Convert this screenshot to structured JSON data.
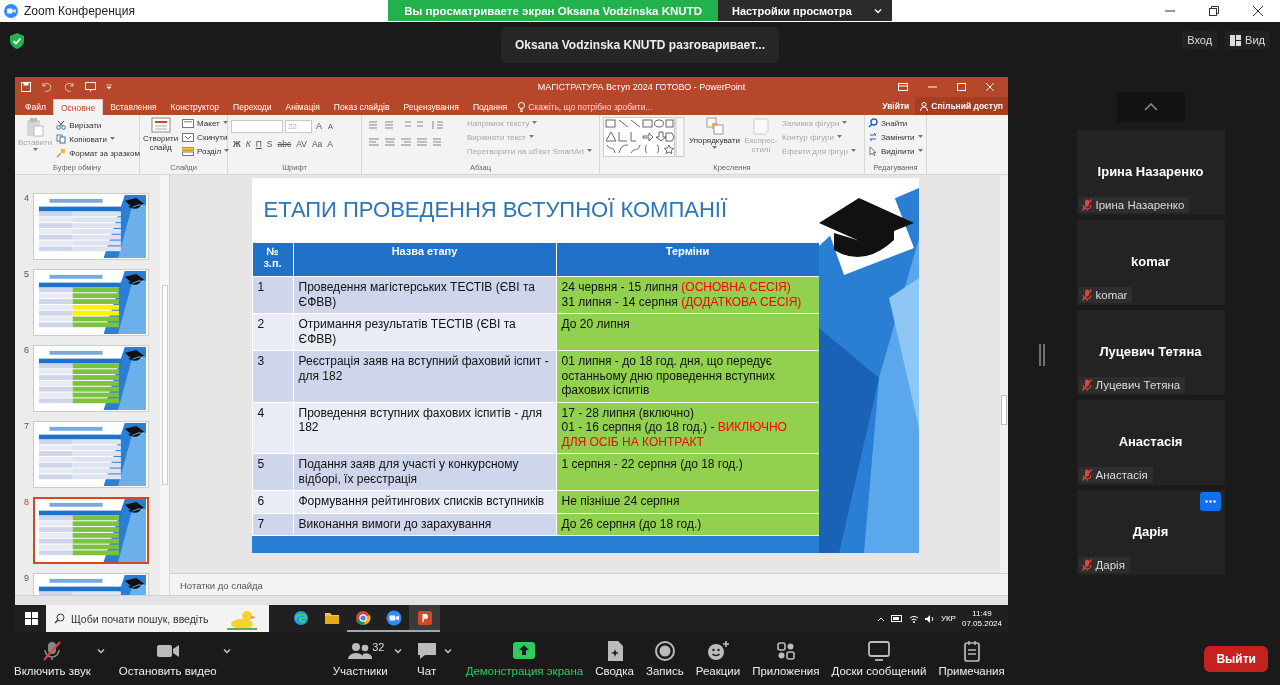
{
  "window": {
    "title": "Zoom Конференция"
  },
  "share_banner": {
    "text": "Вы просматриваете экран Oksana Vodzinska KNUTD",
    "settings": "Настройки просмотра"
  },
  "toast": "Oksana Vodzinska KNUTD разговаривает...",
  "top_right": [
    {
      "label": "Вход",
      "kind": "plain"
    },
    {
      "label": "Вид",
      "kind": "view"
    }
  ],
  "powerpoint": {
    "title": "МАГІСТРАТУРА Вступ 2024 ГОТОВО - PowerPoint",
    "tabs": [
      {
        "label": "Файл",
        "selected": false
      },
      {
        "label": "Основне",
        "selected": true
      },
      {
        "label": "Вставлення",
        "selected": false
      },
      {
        "label": "Конструктор",
        "selected": false
      },
      {
        "label": "Переходи",
        "selected": false
      },
      {
        "label": "Анімація",
        "selected": false
      },
      {
        "label": "Показ слайдів",
        "selected": false
      },
      {
        "label": "Рецензування",
        "selected": false
      },
      {
        "label": "Подання",
        "selected": false
      }
    ],
    "tell_me": "Скажіть, що потрібно зробити...",
    "sign_in": "Увійти",
    "share": "Спільний доступ",
    "ribbon": {
      "clipboard": {
        "label": "Буфер обміну",
        "paste": "Вставити",
        "items": [
          {
            "kind": "cut",
            "label": "Вирізати"
          },
          {
            "kind": "copy",
            "label": "Копіювати"
          },
          {
            "kind": "painter",
            "label": "Формат за зразком"
          }
        ]
      },
      "slides": {
        "label": "Слайди",
        "new_slide": "Створити слайд",
        "items": [
          {
            "kind": "layout",
            "label": "Макет"
          },
          {
            "kind": "reset",
            "label": "Скинути"
          },
          {
            "kind": "section",
            "label": "Розділ"
          }
        ]
      },
      "font": {
        "label": "Шрифт",
        "size": "22",
        "size_buttons": [
          "A",
          "A"
        ],
        "format_buttons": [
          "Ж",
          "К",
          "П",
          "S",
          "abc",
          "AV",
          "Aa",
          "A"
        ]
      },
      "paragraph": {
        "label": "Абзац",
        "items": [
          {
            "label": "Напрямок тексту",
            "disabled": true
          },
          {
            "label": "Вирівняти текст",
            "disabled": true
          },
          {
            "label": "Перетворити на об'єкт SmartArt",
            "disabled": true
          }
        ]
      },
      "drawing": {
        "label": "Креслення",
        "arrange": "Упорядкувати",
        "quick_styles": "Експрес-стилі",
        "items": [
          {
            "label": "Заливка фігури",
            "disabled": true
          },
          {
            "label": "Контур фігури",
            "disabled": true
          },
          {
            "label": "Ефекти для фігур",
            "disabled": true
          }
        ]
      },
      "editing": {
        "label": "Редагування",
        "items": [
          {
            "kind": "find",
            "label": "Знайти"
          },
          {
            "kind": "replace",
            "label": "Замінити"
          },
          {
            "kind": "select",
            "label": "Виділити"
          }
        ]
      }
    },
    "thumbnails": [
      {
        "number": "4",
        "selected": false,
        "kind": "blue"
      },
      {
        "number": "5",
        "selected": false,
        "kind": "yellow"
      },
      {
        "number": "6",
        "selected": false,
        "kind": "green"
      },
      {
        "number": "7",
        "selected": false,
        "kind": "blue"
      },
      {
        "number": "8",
        "selected": true,
        "kind": "green"
      },
      {
        "number": "9",
        "selected": false,
        "kind": "blue"
      }
    ],
    "slide": {
      "title": "ЕТАПИ ПРОВЕДЕННЯ ВСТУПНОЇ КОМПАНІЇ",
      "columns": [
        "№ з.п.",
        "Назва етапу",
        "Терміни"
      ],
      "rows": [
        {
          "number": "1",
          "stage": "Проведення магістерських ТЕСТІВ (ЄВІ та ЄФВВ)",
          "term": [
            [
              {
                "text": "24 червня - 15 липня",
                "alert": false
              },
              {
                "text": "(ОСНОВНА СЕСІЯ)",
                "alert": true
              }
            ],
            [
              {
                "text": "31 липня - 14 серпня",
                "alert": false
              },
              {
                "text": "(ДОДАТКОВА СЕСІЯ)",
                "alert": true
              }
            ]
          ]
        },
        {
          "number": "2",
          "stage": "Отримання результатів ТЕСТІВ (ЄВІ та ЄФВВ)",
          "term": [
            [
              {
                "text": "До 20 липня",
                "alert": false
              }
            ]
          ]
        },
        {
          "number": "3",
          "stage": "Реєстрація заяв на вступний фаховий іспит - для 182",
          "term": [
            [
              {
                "text": "01 липня - до 18 год. дня, що передує останньому дню проведення вступних фахових іспитів",
                "alert": false
              }
            ]
          ]
        },
        {
          "number": "4",
          "stage": "Проведення вступних фахових іспитів - для 182",
          "term": [
            [
              {
                "text": "17 - 28 липня (включно)",
                "alert": false
              }
            ],
            [
              {
                "text": "01 - 16 серпня (до 18 год.) -",
                "alert": false
              },
              {
                "text": "ВИКЛЮЧНО ДЛЯ ОСІБ НА КОНТРАКТ",
                "alert": true
              }
            ]
          ]
        },
        {
          "number": "5",
          "stage": "Подання заяв для участі у конкурсному відборі, їх реєстрація",
          "term": [
            [
              {
                "text": "1 серпня - 22 серпня (до 18 год.)",
                "alert": false
              }
            ]
          ]
        },
        {
          "number": "6",
          "stage": "Формування рейтингових списків вступників",
          "term": [
            [
              {
                "text": "Не пізніше 24 серпня",
                "alert": false
              }
            ]
          ]
        },
        {
          "number": "7",
          "stage": "Виконання вимоги до зарахування",
          "term": [
            [
              {
                "text": "До 26 серпня (до 18 год.)",
                "alert": false
              }
            ]
          ]
        }
      ]
    },
    "notes": "Нотатки до слайда"
  },
  "taskbar": {
    "search_placeholder": "Щоби почати пошук, введіть",
    "apps": [
      {
        "kind": "edge",
        "running": false,
        "selected": false
      },
      {
        "kind": "folder",
        "running": false,
        "selected": false
      },
      {
        "kind": "chrome",
        "running": true,
        "selected": false
      },
      {
        "kind": "zoom",
        "running": true,
        "selected": false
      },
      {
        "kind": "powerpoint",
        "running": true,
        "selected": true
      }
    ],
    "language": "УКР",
    "time": "11:49",
    "date": "07.05.2024"
  },
  "participants": [
    {
      "name": "Ірина Назаренко",
      "label": "Ірина Назаренко",
      "muted": true,
      "show_menu": false
    },
    {
      "name": "komar",
      "label": "komar",
      "muted": true,
      "show_menu": false
    },
    {
      "name": "Луцевич Тетяна",
      "label": "Луцевич Тетяна",
      "muted": true,
      "show_menu": false
    },
    {
      "name": "Анастасія",
      "label": "Анастасія",
      "muted": true,
      "show_menu": false
    },
    {
      "name": "Дарія",
      "label": "Дарія",
      "muted": true,
      "show_menu": true
    }
  ],
  "toolbar": [
    {
      "kind": "audio",
      "label": "Включить звук",
      "caret": true
    },
    {
      "kind": "video",
      "label": "Остановить видео",
      "caret": true
    },
    {
      "kind": "participants",
      "label": "Участники",
      "count": "32",
      "caret": true
    },
    {
      "kind": "chat",
      "label": "Чат",
      "caret": true
    },
    {
      "kind": "share",
      "label": "Демонстрация экрана",
      "caret": false
    },
    {
      "kind": "summary",
      "label": "Сводка",
      "caret": false
    },
    {
      "kind": "record",
      "label": "Запись",
      "caret": false
    },
    {
      "kind": "reactions",
      "label": "Реакции",
      "caret": false
    },
    {
      "kind": "apps",
      "label": "Приложения",
      "caret": false
    },
    {
      "kind": "boards",
      "label": "Доски сообщений",
      "caret": false
    },
    {
      "kind": "notes",
      "label": "Примечания",
      "caret": false
    }
  ],
  "leave": "Выйти"
}
